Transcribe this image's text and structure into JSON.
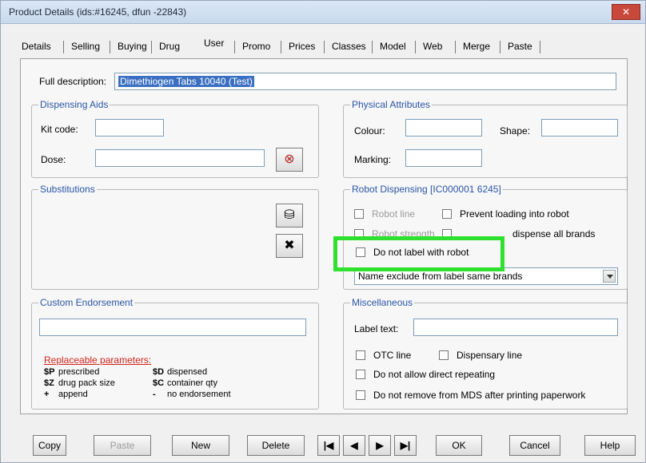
{
  "window": {
    "title": "Product Details (ids:#16245, dfun -22843)",
    "close_label": "✕"
  },
  "tabs": [
    "Details",
    "Selling",
    "Buying",
    "Drug",
    "User",
    "Promo",
    "Prices",
    "Classes",
    "Model",
    "Web",
    "Merge",
    "Paste"
  ],
  "full_description": {
    "label": "Full description:",
    "value": "Dimethiogen Tabs 10040 (Test)"
  },
  "dispensing_aids": {
    "title": "Dispensing Aids",
    "kit_code_label": "Kit code:",
    "dose_label": "Dose:"
  },
  "physical_attributes": {
    "title": "Physical Attributes",
    "colour_label": "Colour:",
    "shape_label": "Shape:",
    "marking_label": "Marking:"
  },
  "substitutions": {
    "title": "Substitutions"
  },
  "robot_dispensing": {
    "title": "Robot Dispensing [IC000001 6245]",
    "robot_line_label": "Robot line",
    "prevent_loading_label": "Prevent loading into robot",
    "robot_strength_label": "Robot strength",
    "dispense_all_brands_label": "dispense all brands",
    "do_not_label_label": "Do not label with robot",
    "brands_select_value": "Name exclude from label same brands"
  },
  "custom_endorsement": {
    "title": "Custom Endorsement",
    "replaceable_parameters_title": "Replaceable parameters:",
    "params": [
      {
        "code": "$P",
        "desc": "prescribed"
      },
      {
        "code": "$Z",
        "desc": "drug pack size"
      },
      {
        "code": "+",
        "desc": "append"
      },
      {
        "code": "$D",
        "desc": "dispensed"
      },
      {
        "code": "$C",
        "desc": "container qty"
      },
      {
        "code": "-",
        "desc": "no endorsement"
      }
    ]
  },
  "miscellaneous": {
    "title": "Miscellaneous",
    "label_text_label": "Label text:",
    "otc_line_label": "OTC line",
    "dispensary_line_label": "Dispensary line",
    "do_not_allow_repeating_label": "Do not allow direct repeating",
    "do_not_remove_label": "Do not remove from MDS after printing paperwork"
  },
  "footer": {
    "copy": "Copy",
    "paste": "Paste",
    "new": "New",
    "delete": "Delete",
    "first": "|◀",
    "prev": "◀",
    "next": "▶",
    "last": "▶|",
    "ok": "OK",
    "cancel": "Cancel",
    "help": "Help"
  }
}
